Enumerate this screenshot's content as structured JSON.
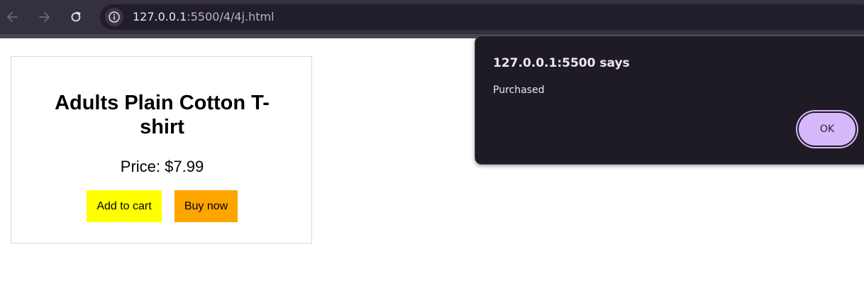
{
  "browser": {
    "url_host": "127.0.0.1",
    "url_rest": ":5500/4/4j.html",
    "icons": {
      "back": "arrow-left-icon",
      "forward": "arrow-right-icon",
      "reload": "reload-icon",
      "info": "info-icon"
    }
  },
  "product": {
    "title": "Adults Plain Cotton T-shirt",
    "price": "Price: $7.99",
    "add_to_cart_label": "Add to cart",
    "buy_now_label": "Buy now",
    "colors": {
      "add_to_cart": "#ffff00",
      "buy_now": "#ffa500"
    }
  },
  "dialog": {
    "title": "127.0.0.1:5500 says",
    "message": "Purchased",
    "ok_label": "OK",
    "accent": "#d7b9fb"
  }
}
